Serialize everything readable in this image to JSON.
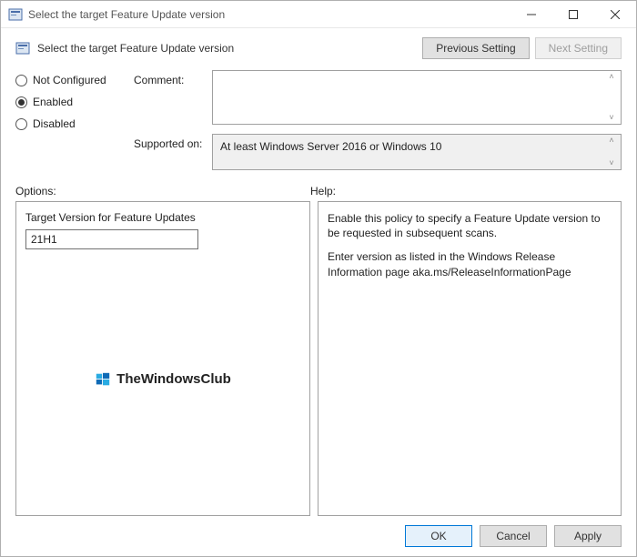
{
  "titlebar": {
    "title": "Select the target Feature Update version"
  },
  "header": {
    "title": "Select the target Feature Update version",
    "prev": "Previous Setting",
    "next": "Next Setting"
  },
  "radios": {
    "not_configured": "Not Configured",
    "enabled": "Enabled",
    "disabled": "Disabled"
  },
  "fields": {
    "comment_label": "Comment:",
    "comment_value": "",
    "supported_label": "Supported on:",
    "supported_value": "At least Windows Server 2016 or Windows 10"
  },
  "panels": {
    "options_label": "Options:",
    "help_label": "Help:"
  },
  "options": {
    "target_label": "Target Version for Feature Updates",
    "target_value": "21H1"
  },
  "help": {
    "p1": "Enable this policy to specify a Feature Update version to be requested in subsequent scans.",
    "p2": "Enter version as listed in the Windows Release Information page aka.ms/ReleaseInformationPage"
  },
  "watermark": {
    "text": "TheWindowsClub"
  },
  "footer": {
    "ok": "OK",
    "cancel": "Cancel",
    "apply": "Apply"
  }
}
